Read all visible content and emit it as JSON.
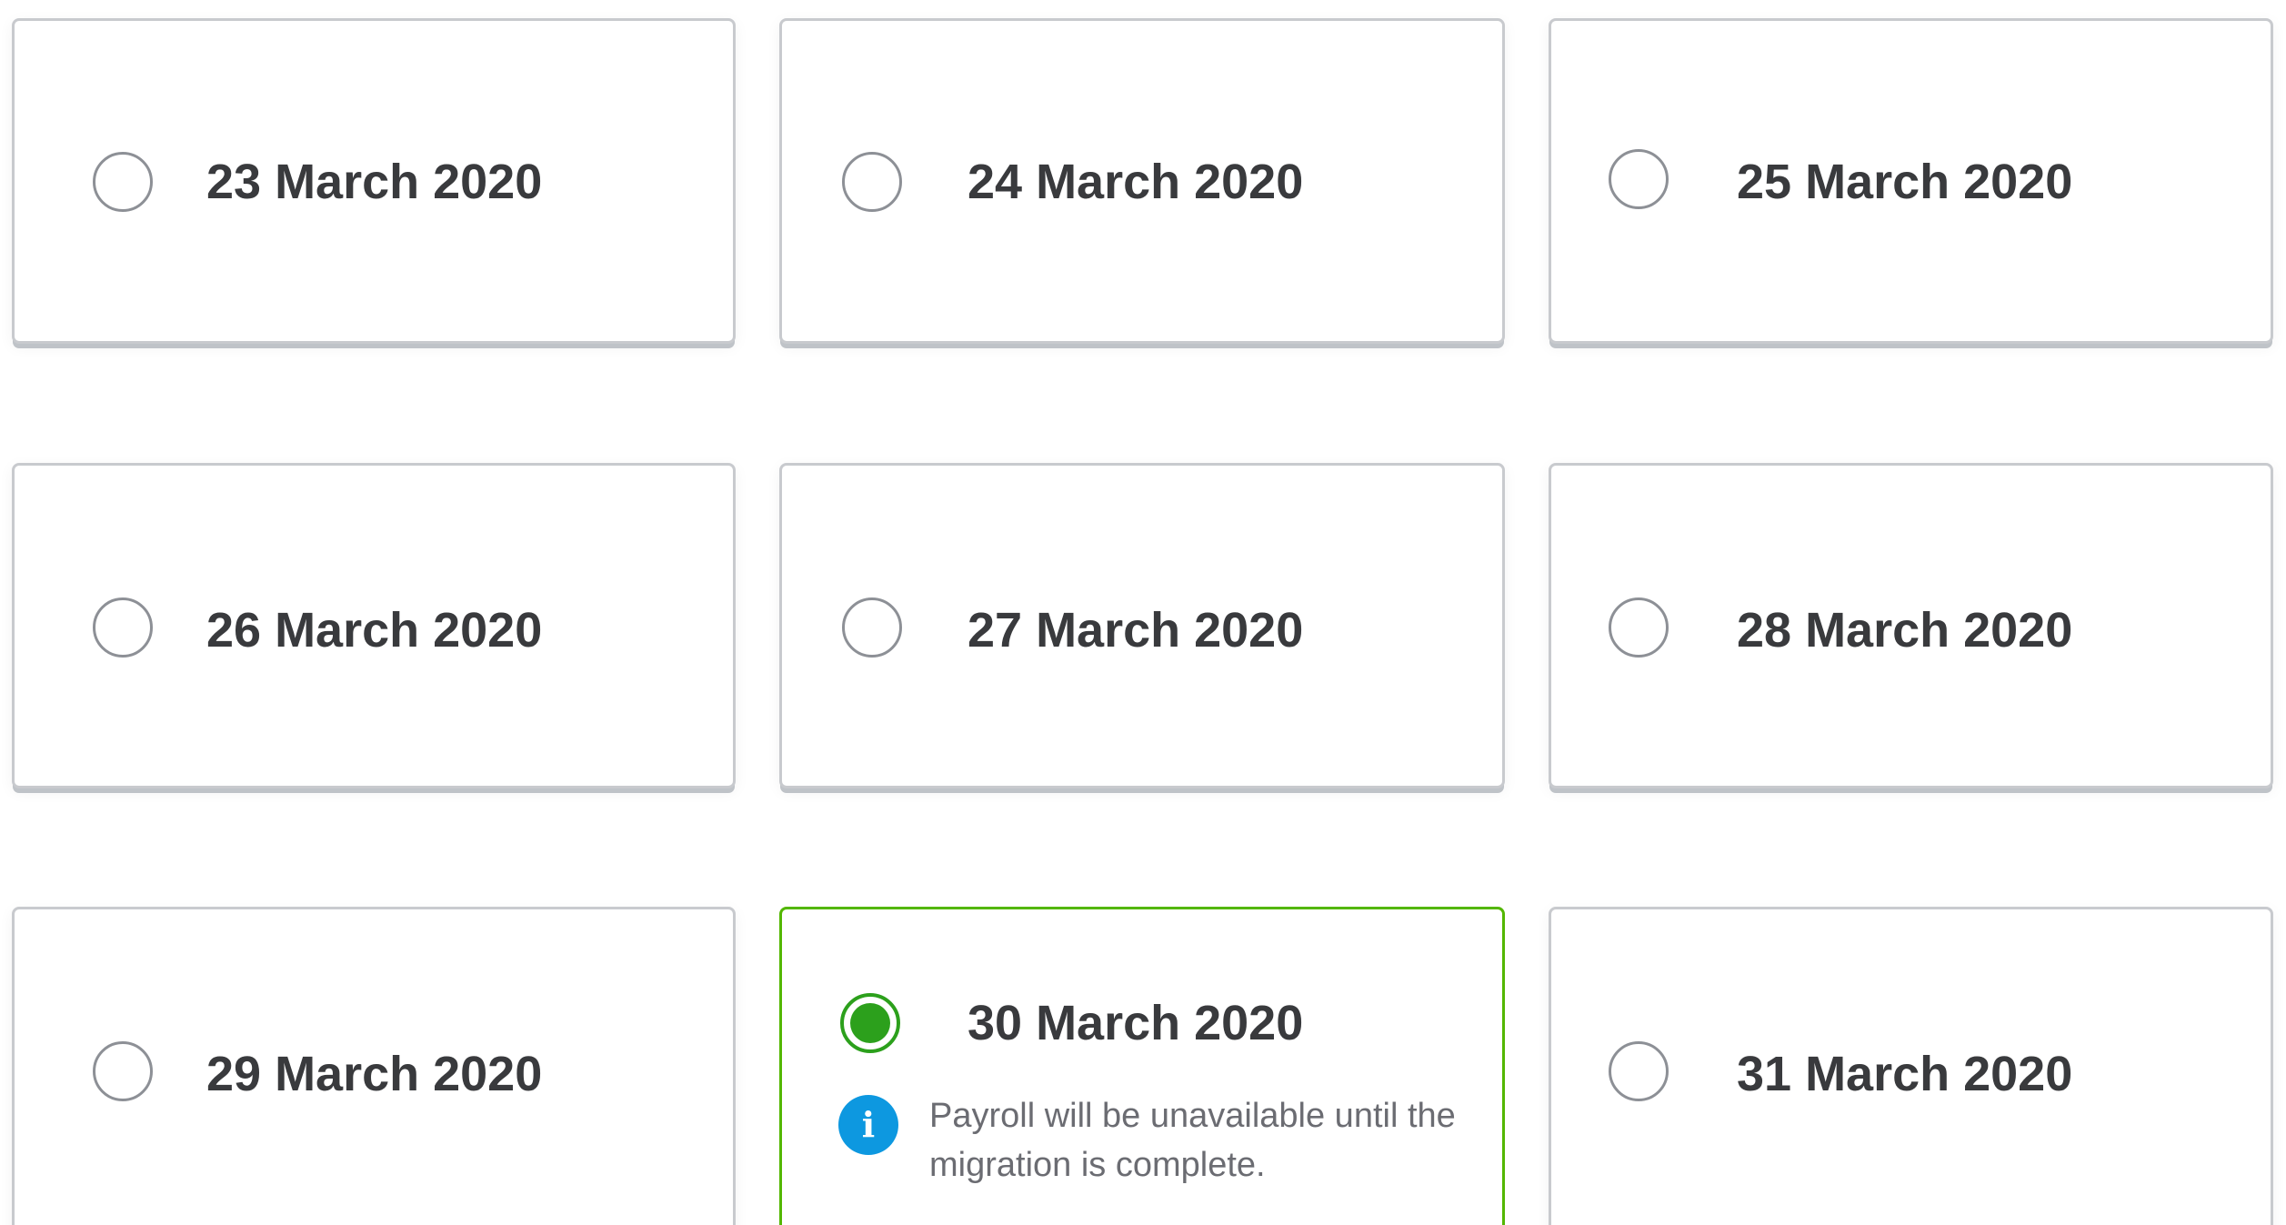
{
  "dates": [
    {
      "label": "23 March 2020",
      "selected": false
    },
    {
      "label": "24 March 2020",
      "selected": false
    },
    {
      "label": "25 March 2020",
      "selected": false
    },
    {
      "label": "26 March 2020",
      "selected": false
    },
    {
      "label": "27 March 2020",
      "selected": false
    },
    {
      "label": "28 March 2020",
      "selected": false
    },
    {
      "label": "29 March 2020",
      "selected": false
    },
    {
      "label": "30 March 2020",
      "selected": true
    },
    {
      "label": "31 March 2020",
      "selected": false
    }
  ],
  "selected_info": {
    "icon": "info-icon",
    "icon_glyph": "i",
    "message": "Payroll will be unavailable until the migration is complete."
  },
  "colors": {
    "selected_border": "#53b700",
    "radio_selected": "#2ca01c",
    "info_icon": "#0d98e0",
    "label_text": "#393a3d",
    "muted_text": "#6b6c72"
  }
}
